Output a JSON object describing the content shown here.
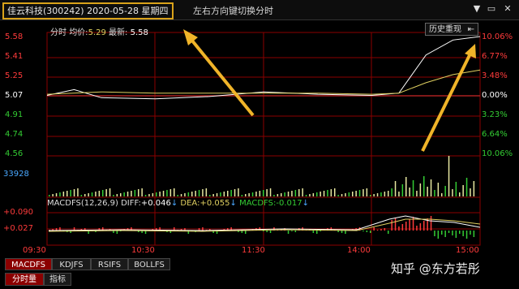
{
  "window": {
    "title": "佳云科技(300242) 2020-05-28 星期四",
    "hint": "左右方向键切换分时",
    "buttons": {
      "minimize": "▼",
      "restore": "▭",
      "close": "✕"
    }
  },
  "price_panel": {
    "info_label": "分时",
    "avg_label": "均价:",
    "avg_value": "5.29",
    "last_label": "最新:",
    "last_value": "5.58",
    "history_label": "历史重现",
    "left_ticks": [
      "5.58",
      "5.41",
      "5.25",
      "5.07",
      "4.91",
      "4.74",
      "4.56"
    ],
    "right_ticks": [
      "10.06%",
      "6.77%",
      "3.48%",
      "0.00%",
      "3.23%",
      "6.64%",
      "10.06%"
    ]
  },
  "volume_panel": {
    "max_label": "33928"
  },
  "macd_panel": {
    "name": "MACDFS(12,26,9)",
    "diff_label": "DIFF:",
    "diff_value": "+0.046",
    "dea_label": "DEA:",
    "dea_value": "+0.055",
    "macd_label": "MACDFS:",
    "macd_value": "-0.017",
    "ticks": [
      "+0.090",
      "+0.027"
    ]
  },
  "time_axis": [
    "09:30",
    "10:30",
    "11:30",
    "14:00",
    "15:00"
  ],
  "indicator_tabs": [
    "MACDFS",
    "KDJFS",
    "RSIFS",
    "BOLLFS"
  ],
  "bottom_tabs": [
    "分时量",
    "指标"
  ],
  "watermark": "知乎 @东方若彤",
  "colors": {
    "up": "#ff3b3b",
    "down": "#33cc33",
    "price_line": "#ffffff",
    "avg_line": "#e0d060",
    "grid": "#8b0000",
    "arrow": "#f0b429"
  },
  "chart_data": {
    "type": "line",
    "x_range": [
      "09:30",
      "15:00"
    ],
    "ylim": [
      4.56,
      5.58
    ],
    "prev_close": 5.07,
    "series": [
      {
        "name": "",
        "x": [
          "09:30",
          "09:45",
          "10:00",
          "10:30",
          "11:00",
          "11:30",
          "13:30",
          "14:00",
          "14:15",
          "14:30",
          "14:45",
          "15:00"
        ],
        "values": [
          5.07,
          5.12,
          5.05,
          5.04,
          5.06,
          5.1,
          5.08,
          5.07,
          5.09,
          5.42,
          5.55,
          5.58
        ]
      },
      {
        "name": "",
        "x": [
          "09:30",
          "10:00",
          "10:30",
          "11:00",
          "11:30",
          "13:30",
          "14:00",
          "14:15",
          "14:30",
          "14:45",
          "15:00"
        ],
        "values": [
          5.08,
          5.1,
          5.09,
          5.09,
          5.09,
          5.09,
          5.08,
          5.09,
          5.18,
          5.25,
          5.29
        ]
      }
    ]
  }
}
